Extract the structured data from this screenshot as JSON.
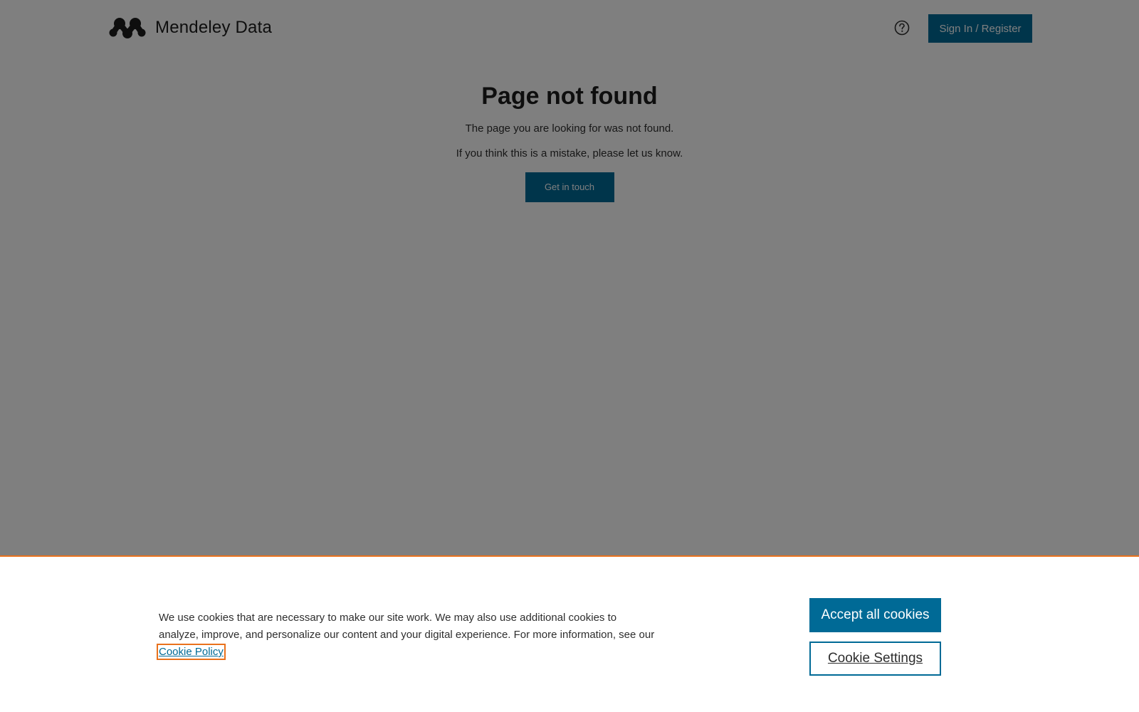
{
  "header": {
    "logo_text": "Mendeley Data",
    "logo_icon": "mendeley-logo-icon",
    "help_icon": "question-circle-icon",
    "signin_label": "Sign In / Register"
  },
  "main": {
    "title": "Page not found",
    "message_1": "The page you are looking for was not found.",
    "message_2": "If you think this is a mistake, please let us know.",
    "cta_label": "Get in touch"
  },
  "cookie_banner": {
    "text": "We use cookies that are necessary to make our site work. We may also use additional cookies to analyze, improve, and personalize our content and your digital experience. For more information, see our ",
    "policy_link": "Cookie Policy",
    "accept_label": "Accept all cookies",
    "settings_label": "Cookie Settings"
  },
  "colors": {
    "brand": "#006a96",
    "accent": "#e9711c",
    "overlay": "rgba(0,0,0,0.5)"
  }
}
